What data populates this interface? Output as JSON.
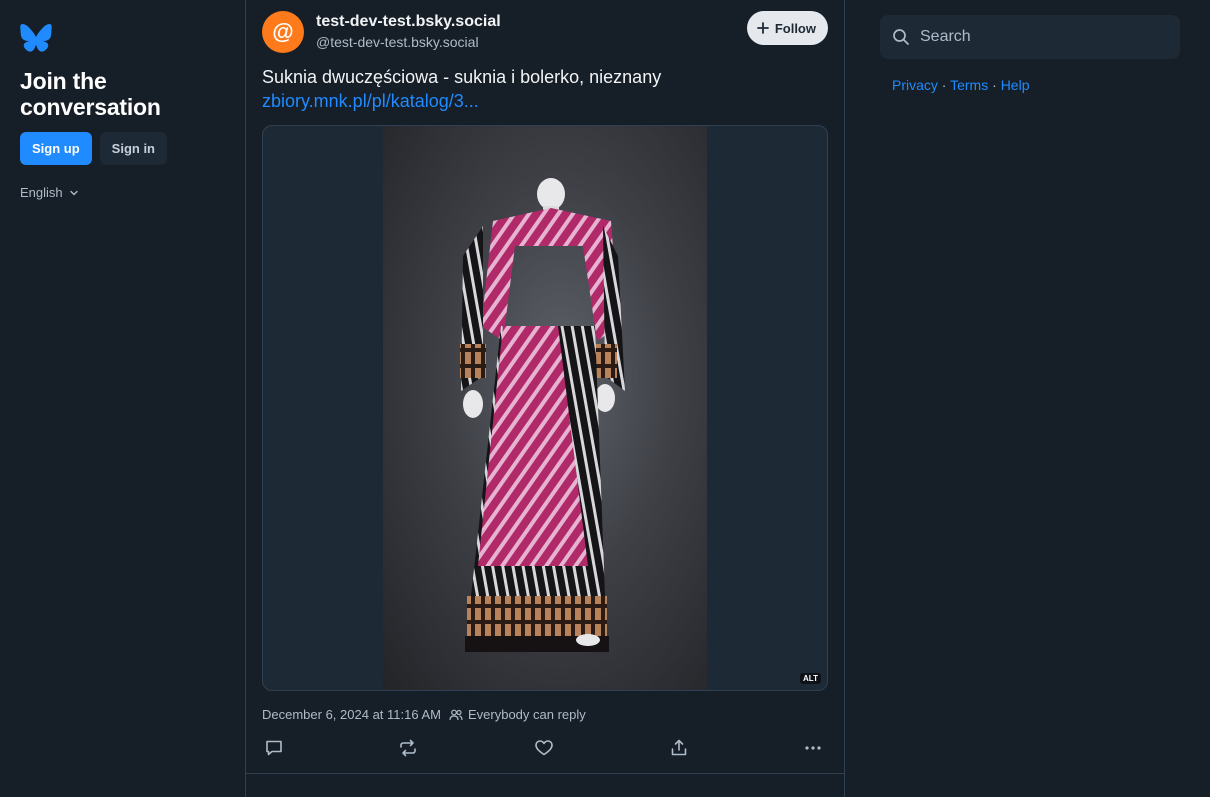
{
  "left_nav": {
    "join_title": "Join the conversation",
    "signup_label": "Sign up",
    "signin_label": "Sign in",
    "language": "English"
  },
  "post": {
    "author": {
      "avatar_symbol": "@",
      "display_name": "test-dev-test.bsky.social",
      "handle": "@test-dev-test.bsky.social"
    },
    "follow_label": "Follow",
    "text": "Suknia dwuczęściowa - suknia i bolerko, nieznany",
    "link_text": "zbiory.mnk.pl/pl/katalog/3...",
    "image_alt_badge": "ALT",
    "timestamp": "December 6, 2024 at 11:16 AM",
    "reply_setting": "Everybody can reply"
  },
  "right": {
    "search_placeholder": "Search",
    "footer": {
      "privacy": "Privacy",
      "terms": "Terms",
      "help": "Help",
      "separator": " · "
    }
  },
  "colors": {
    "background": "#161e27",
    "accent": "#208bfe",
    "avatar": "#ff7a1a"
  }
}
